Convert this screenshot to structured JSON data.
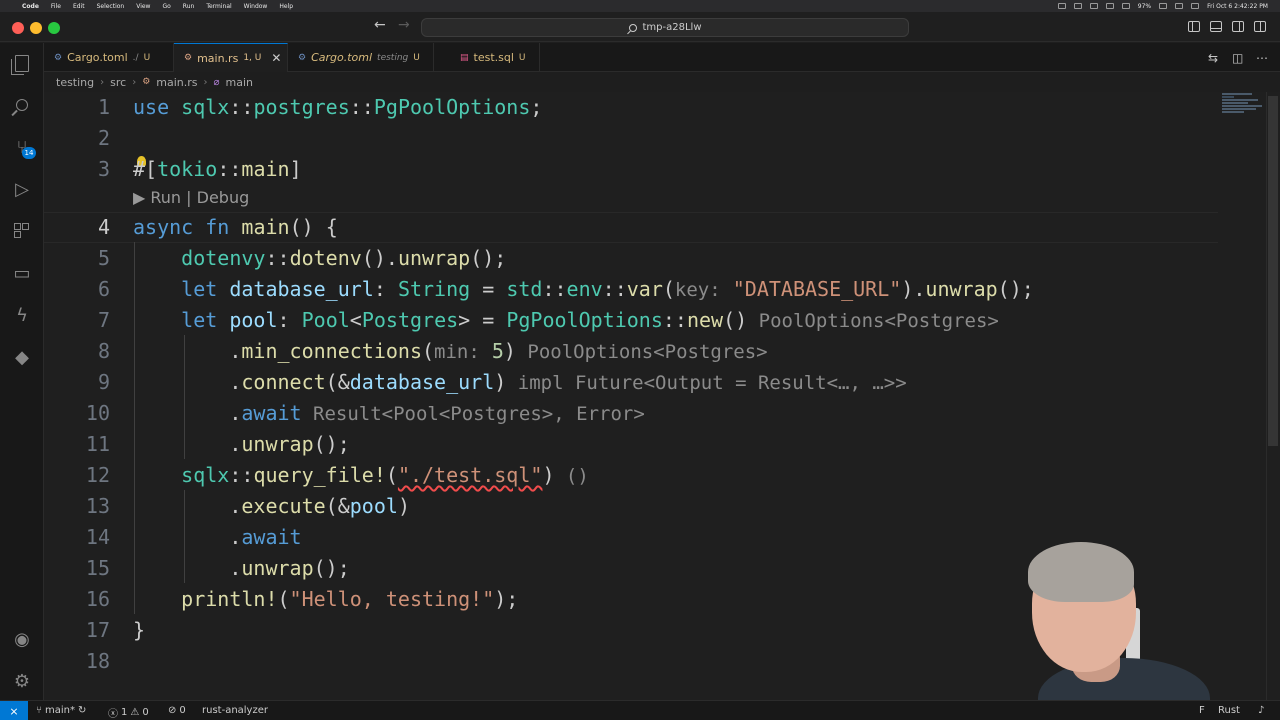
{
  "menubar": {
    "items": [
      "Code",
      "File",
      "Edit",
      "Selection",
      "View",
      "Go",
      "Run",
      "Terminal",
      "Window",
      "Help"
    ],
    "battery": "97%",
    "clock": "Fri Oct 6  2:42:22 PM"
  },
  "titlebar": {
    "search_text": "tmp-a28Llw"
  },
  "activitybar": {
    "scm_badge": "14"
  },
  "tabs": [
    {
      "label": "Cargo.toml",
      "description": "./",
      "status": "U"
    },
    {
      "label": "main.rs",
      "description": "",
      "status": "1, U"
    },
    {
      "label": "Cargo.toml",
      "description": "testing",
      "status": "U"
    },
    {
      "label": "test.sql",
      "description": "",
      "status": "U"
    }
  ],
  "breadcrumb": [
    "testing",
    "src",
    "main.rs",
    "main"
  ],
  "editor": {
    "line_numbers": [
      "1",
      "2",
      "3",
      "4",
      "5",
      "6",
      "7",
      "8",
      "9",
      "10",
      "11",
      "12",
      "13",
      "14",
      "15",
      "16",
      "17",
      "18"
    ],
    "active_line": "4",
    "codelens": "▶ Run | Debug",
    "lines": [
      {
        "text": "use sqlx::postgres::PgPoolOptions;"
      },
      {
        "text": ""
      },
      {
        "text": "#[tokio::main]"
      },
      {
        "text": "async fn main() {"
      },
      {
        "text": "    dotenvy::dotenv().unwrap();"
      },
      {
        "text": "    let database_url: String = std::env::var(key: \"DATABASE_URL\").unwrap();"
      },
      {
        "text": "    let pool: Pool<Postgres> = PgPoolOptions::new() PoolOptions<Postgres>"
      },
      {
        "text": "        .min_connections(min: 5) PoolOptions<Postgres>"
      },
      {
        "text": "        .connect(&database_url) impl Future<Output = Result<…, …>>"
      },
      {
        "text": "        .await Result<Pool<Postgres>, Error>"
      },
      {
        "text": "        .unwrap();"
      },
      {
        "text": "    sqlx::query_file!(\"./test.sql\") ()"
      },
      {
        "text": "        .execute(&pool)"
      },
      {
        "text": "        .await"
      },
      {
        "text": "        .unwrap();"
      },
      {
        "text": "    println!(\"Hello, testing!\");"
      },
      {
        "text": "}"
      },
      {
        "text": ""
      }
    ]
  },
  "statusbar": {
    "branch": "main*",
    "errors": "1",
    "warnings": "0",
    "ports": "0",
    "analyzer": "rust-analyzer",
    "language": "Rust"
  }
}
